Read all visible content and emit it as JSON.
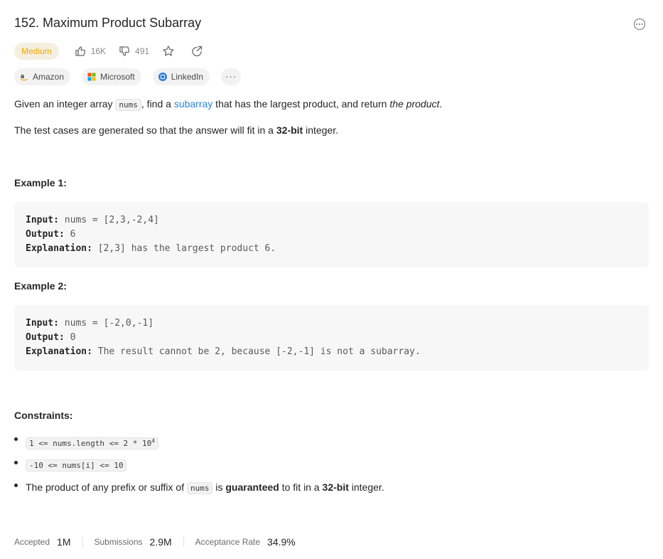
{
  "problem": {
    "title": "152. Maximum Product Subarray",
    "difficulty": "Medium",
    "likes": "16K",
    "dislikes": "491"
  },
  "tags": [
    {
      "label": "Amazon",
      "icon": "amazon-icon"
    },
    {
      "label": "Microsoft",
      "icon": "microsoft-icon"
    },
    {
      "label": "LinkedIn",
      "icon": "linkedin-icon"
    }
  ],
  "tags_more": "···",
  "description": {
    "p1_a": "Given an integer array ",
    "p1_code": "nums",
    "p1_b": ", find a ",
    "p1_link": "subarray",
    "p1_c": " that has the largest product, and return ",
    "p1_em": "the product",
    "p1_d": ".",
    "p2_a": "The test cases are generated so that the answer will fit in a ",
    "p2_bold": "32-bit",
    "p2_b": " integer."
  },
  "examples": [
    {
      "heading": "Example 1:",
      "input_label": "Input:",
      "input": " nums = [2,3,-2,4]",
      "output_label": "Output:",
      "output": " 6",
      "explanation_label": "Explanation:",
      "explanation": " [2,3] has the largest product 6."
    },
    {
      "heading": "Example 2:",
      "input_label": "Input:",
      "input": " nums = [-2,0,-1]",
      "output_label": "Output:",
      "output": " 0",
      "explanation_label": "Explanation:",
      "explanation": " The result cannot be 2, because [-2,-1] is not a subarray."
    }
  ],
  "constraints": {
    "heading": "Constraints:",
    "c1": "1 <= nums.length <= 2 * 10",
    "c1_sup": "4",
    "c2": "-10 <= nums[i] <= 10",
    "c3_a": "The product of any prefix or suffix of ",
    "c3_code": "nums",
    "c3_b": " is ",
    "c3_bold1": "guaranteed",
    "c3_c": " to fit in a ",
    "c3_bold2": "32-bit",
    "c3_d": " integer."
  },
  "footer": {
    "accepted_label": "Accepted",
    "accepted": "1M",
    "submissions_label": "Submissions",
    "submissions": "2.9M",
    "rate_label": "Acceptance Rate",
    "rate": "34.9%"
  },
  "colors": {
    "medium": "#f0a500",
    "link": "#2a86d8"
  }
}
